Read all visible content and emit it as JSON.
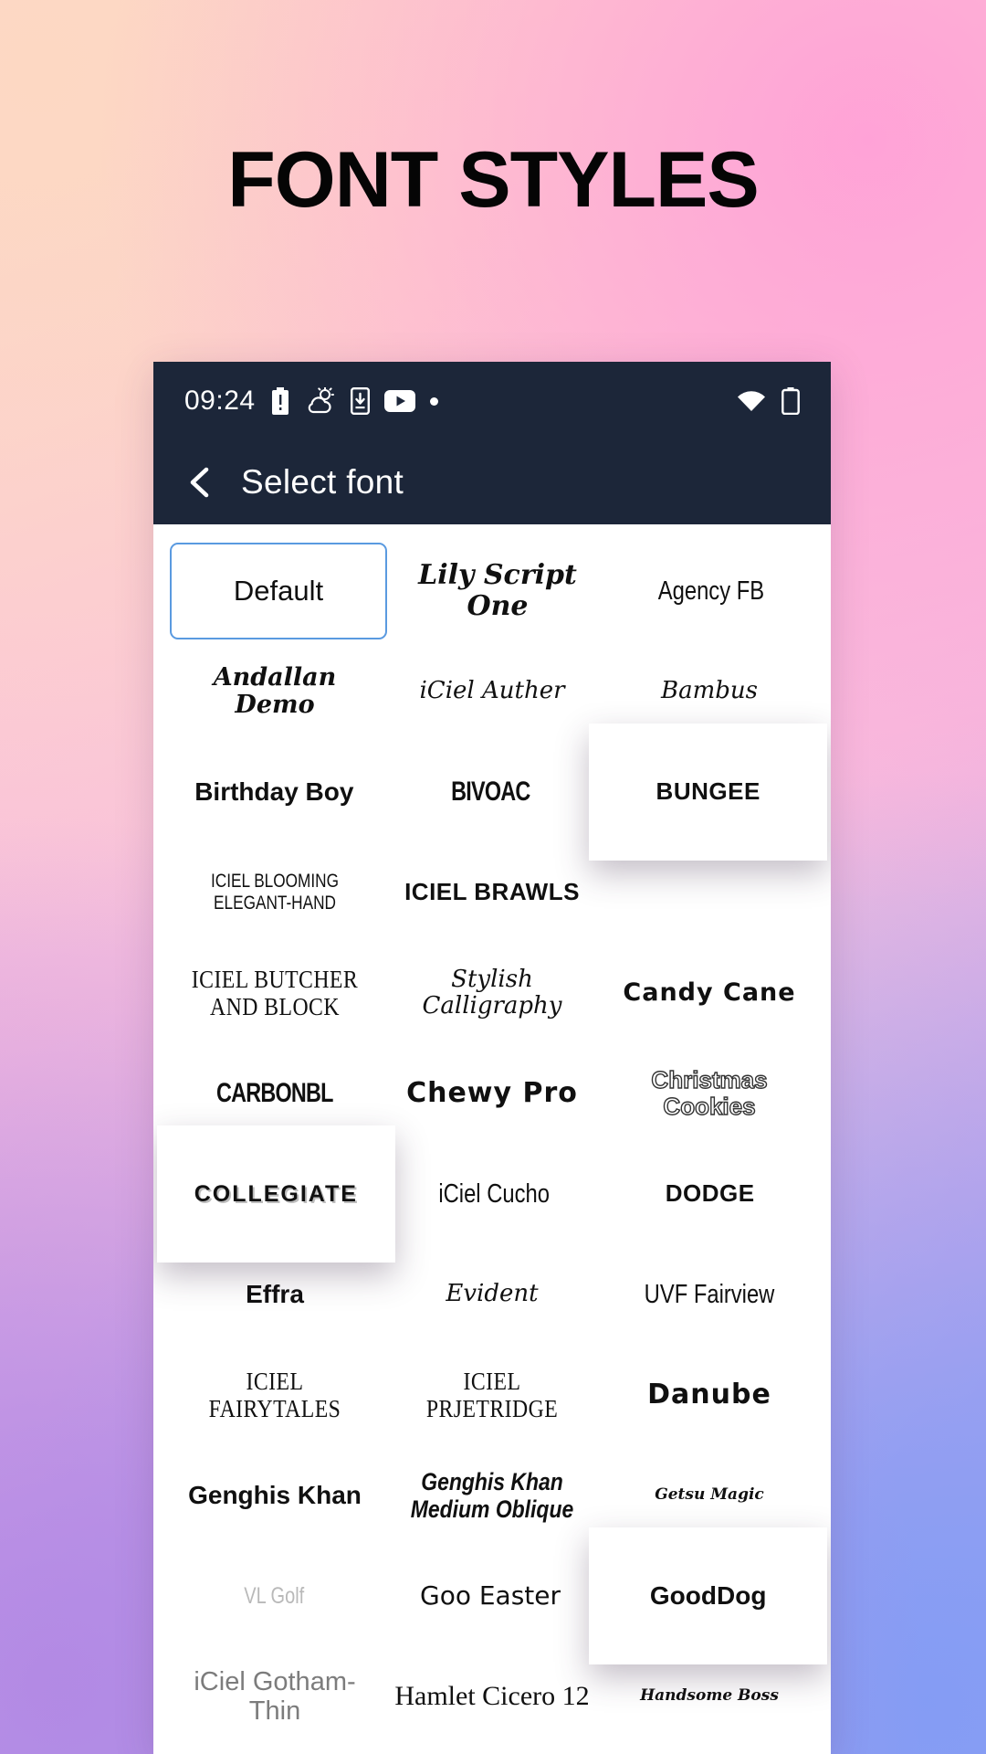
{
  "poster": {
    "title": "FONT STYLES"
  },
  "phone": {
    "statusbar": {
      "time": "09:24",
      "left_icons": [
        "battery-alert-icon",
        "weather-partly-cloudy-icon",
        "download-to-phone-icon",
        "youtube-icon",
        "overflow-dot-icon"
      ],
      "right_icons": [
        "wifi-icon",
        "battery-icon"
      ]
    },
    "toolbar": {
      "back_icon": "back-chevron-icon",
      "title": "Select font"
    },
    "selected_font": "Default",
    "accent_selected_border": "#5a9ae0",
    "toolbar_bg": "#1c2639",
    "font_rows": [
      [
        {
          "label": "Default",
          "style": "f-default",
          "state": "selected"
        },
        {
          "label": "Lily Script One",
          "style": "f-script",
          "state": "normal"
        },
        {
          "label": "Agency FB",
          "style": "f-condensed",
          "state": "normal"
        }
      ],
      [
        {
          "label": "Andallan Demo",
          "style": "f-handscript",
          "state": "normal"
        },
        {
          "label": "iCiel Auther",
          "style": "f-thinscript",
          "state": "normal"
        },
        {
          "label": "Bambus",
          "style": "f-thinscript",
          "state": "normal"
        }
      ],
      [
        {
          "label": "Birthday Boy",
          "style": "f-bold",
          "state": "normal"
        },
        {
          "label": "BIVOAC",
          "style": "f-blackcond",
          "state": "normal"
        },
        {
          "label": "BUNGEE",
          "style": "f-caps-bold",
          "state": "popup"
        }
      ],
      [
        {
          "label": "ICIEL BLOOMING ELEGANT-HAND",
          "style": "f-caps-thin",
          "state": "normal"
        },
        {
          "label": "ICIEL BRAWLS",
          "style": "f-caps-bold",
          "state": "normal"
        },
        {
          "label": "",
          "style": "f-default",
          "state": "empty"
        }
      ],
      [
        {
          "label": "ICIEL BUTCHER AND BLOCK",
          "style": "f-serifcaps",
          "state": "normal"
        },
        {
          "label": "Stylish Calligraphy",
          "style": "f-thinscript",
          "state": "normal"
        },
        {
          "label": "Candy Cane",
          "style": "f-dotted",
          "state": "normal"
        }
      ],
      [
        {
          "label": "CARBONBL",
          "style": "f-blackcond",
          "state": "normal"
        },
        {
          "label": "Chewy Pro",
          "style": "f-rounded",
          "state": "normal"
        },
        {
          "label": "Christmas Cookies",
          "style": "f-outline",
          "state": "normal"
        }
      ],
      [
        {
          "label": "COLLEGIATE",
          "style": "f-shadowcap",
          "state": "popup"
        },
        {
          "label": "iCiel Cucho",
          "style": "f-condensed",
          "state": "normal"
        },
        {
          "label": "DODGE",
          "style": "f-caps-bold",
          "state": "normal"
        }
      ],
      [
        {
          "label": "Effra",
          "style": "f-bold",
          "state": "normal"
        },
        {
          "label": "Evident",
          "style": "f-thinscript",
          "state": "normal"
        },
        {
          "label": "UVF Fairview",
          "style": "f-condensed",
          "state": "normal"
        }
      ],
      [
        {
          "label": "ICIEL FAIRYTALES",
          "style": "f-serifcaps",
          "state": "normal"
        },
        {
          "label": "ICIEL PRJETRIDGE",
          "style": "f-serifcaps",
          "state": "normal"
        },
        {
          "label": "Danube",
          "style": "f-rounded",
          "state": "normal"
        }
      ],
      [
        {
          "label": "Genghis Khan",
          "style": "f-bold",
          "state": "normal"
        },
        {
          "label": "Genghis Khan Medium Oblique",
          "style": "f-oblique",
          "state": "normal"
        },
        {
          "label": "Getsu Magic",
          "style": "f-tinyscript",
          "state": "normal"
        }
      ],
      [
        {
          "label": "VL Golf",
          "style": "f-ghost",
          "state": "normal"
        },
        {
          "label": "Goo Easter",
          "style": "f-marker",
          "state": "normal"
        },
        {
          "label": "GoodDog",
          "style": "f-bold",
          "state": "popup"
        }
      ],
      [
        {
          "label": "iCiel Gotham-Thin",
          "style": "f-thin",
          "state": "normal"
        },
        {
          "label": "Hamlet Cicero 12",
          "style": "f-serif",
          "state": "normal"
        },
        {
          "label": "Handsome Boss",
          "style": "f-tinyscript",
          "state": "normal"
        }
      ]
    ]
  }
}
